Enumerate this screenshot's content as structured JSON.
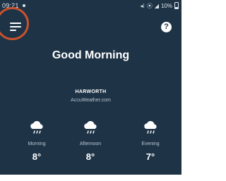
{
  "status_bar": {
    "time": "09:21",
    "battery_text": "10%"
  },
  "header": {
    "menu_icon": "hamburger-menu-icon",
    "help_label": "?"
  },
  "greeting": "Good Morning",
  "location": {
    "name": "HARWORTH",
    "source": "AccuWeather.com"
  },
  "forecast": [
    {
      "label": "Morning",
      "temperature": "8°",
      "icon": "rain-cloud-icon"
    },
    {
      "label": "Afternoon",
      "temperature": "8°",
      "icon": "rain-cloud-icon"
    },
    {
      "label": "Evening",
      "temperature": "7°",
      "icon": "rain-cloud-icon"
    }
  ],
  "colors": {
    "background": "#1e3346",
    "highlight_ring": "#c9522e",
    "text": "#ffffff",
    "muted_text": "#b9c6d1"
  }
}
